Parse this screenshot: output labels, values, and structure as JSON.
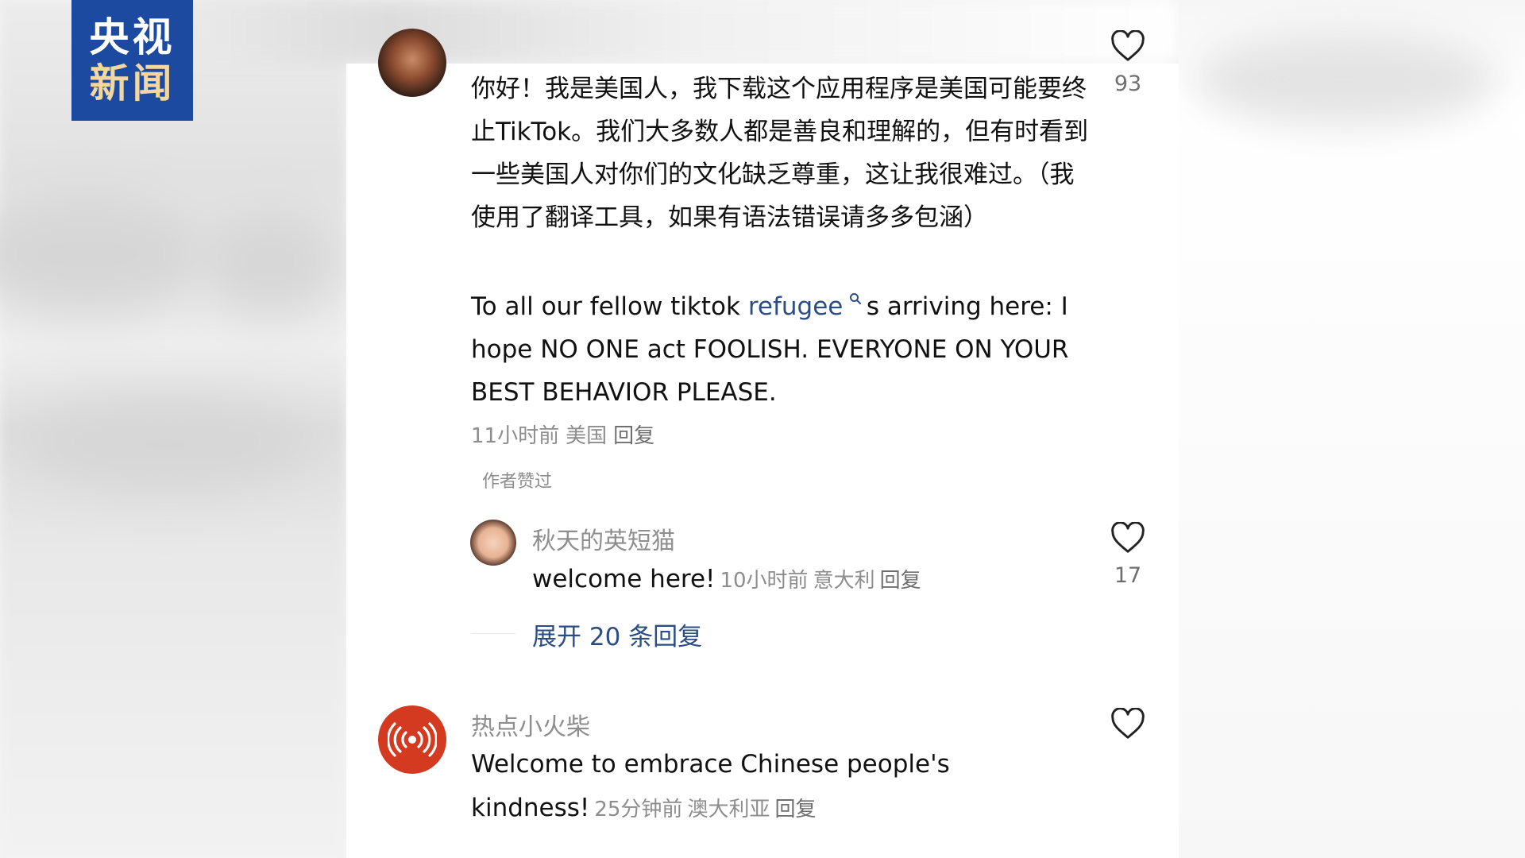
{
  "logo": {
    "line1": "央视",
    "line2": "新闻"
  },
  "comments": {
    "main": {
      "body_cn": "你好！我是美国人，我下载这个应用程序是美国可能要终止TikTok。我们大多数人都是善良和理解的，但有时看到一些美国人对你们的文化缺乏尊重，这让我很难过。（我使用了翻译工具，如果有语法错误请多多包涵）",
      "body_en_before": "To all our fellow tiktok ",
      "body_en_link": "refugee",
      "body_en_after": "s arriving here: I hope NO ONE act FOOLISH. EVERYONE ON YOUR BEST BEHAVIOR PLEASE.",
      "time": "11小时前",
      "region": "美国",
      "reply_label": "回复",
      "likes": "93",
      "liked_by_author": "作者赞过"
    },
    "reply": {
      "username": "秋天的英短猫",
      "text": "welcome here!",
      "time": "10小时前",
      "region": "意大利",
      "reply_label": "回复",
      "likes": "17"
    },
    "expand_label": "展开 20 条回复",
    "second": {
      "username": "热点小火柴",
      "text_line1": "Welcome to embrace Chinese people's",
      "text_line2": "kindness!",
      "time": "25分钟前",
      "region": "澳大利亚",
      "reply_label": "回复"
    }
  },
  "icons": {
    "like": "heart-outline-icon",
    "search": "magnifier-icon",
    "broadcast": "broadcast-icon"
  },
  "colors": {
    "logo_bg": "#1b4aa0",
    "link_blue": "#2b4d86",
    "meta_gray": "#8d8d8d",
    "avatar_red": "#d43a20"
  }
}
